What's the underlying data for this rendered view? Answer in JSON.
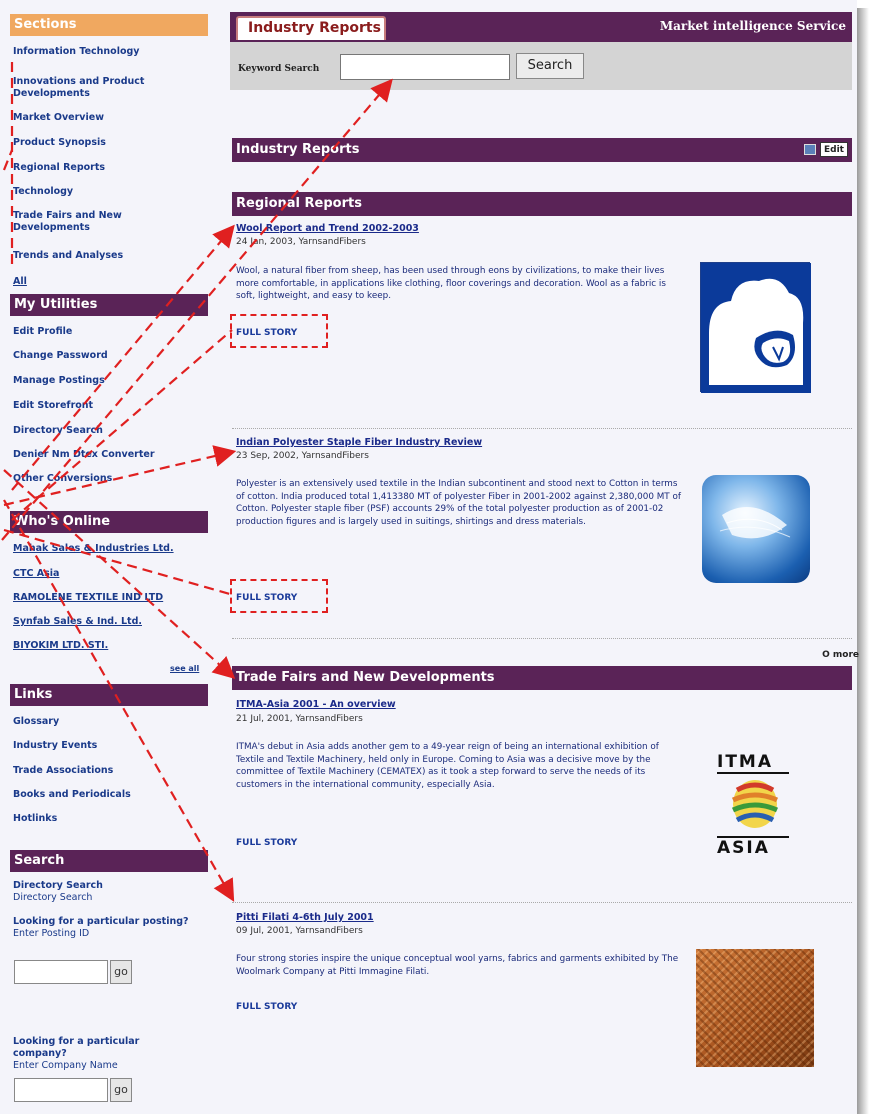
{
  "sidebar": {
    "sections_heading": "Sections",
    "sections": [
      "Information Technology",
      "Innovations and Product Developments",
      "Market Overview",
      "Product Synopsis",
      "Regional Reports",
      "Technology",
      "Trade Fairs and New Developments",
      "Trends and Analyses",
      "All"
    ],
    "utilities_heading": "My Utilities",
    "utilities": [
      "Edit Profile",
      "Change Password",
      "Manage Postings",
      "Edit Storefront",
      "Directory Search",
      "Denier Nm Dtex Converter",
      "Other Conversions"
    ],
    "whos_online_heading": "Who's Online",
    "online": [
      "Mahak Sales & Industries Ltd.",
      "CTC Asia",
      "RAMOLENE TEXTILE IND LTD",
      "Synfab Sales & Ind. Ltd.",
      "BIYOKIM LTD. STI."
    ],
    "online_more": "see all",
    "links_heading": "Links",
    "links": [
      "Glossary",
      "Industry Events",
      "Trade Associations",
      "Books and Periodicals",
      "Hotlinks"
    ],
    "search_heading": "Search",
    "dir_search_title": "Directory Search",
    "dir_search_sub": "Directory Search",
    "posting_q": "Looking for a particular posting?",
    "posting_label": "Enter Posting ID",
    "company_q": "Looking for a particular company?",
    "company_label": "Enter Company Name",
    "go_label": "go"
  },
  "header": {
    "tab_title": "Industry Reports",
    "service": "Market intelligence Service",
    "keyword_label": "Keyword Search",
    "search_button": "Search"
  },
  "main": {
    "industry_reports_bar": "Industry Reports",
    "edit_label": "Edit",
    "regional_bar": "Regional Reports",
    "trade_bar": "Trade Fairs and New Developments",
    "more_label": "O more",
    "full_story": "FULL STORY",
    "articles": [
      {
        "title": "Wool Report and Trend 2002-2003",
        "date": "24 Jan, 2003, YarnsandFibers",
        "body": "Wool, a natural fiber from sheep, has been used through eons by civilizations, to make their lives more comfortable, in applications like clothing, floor coverings and decoration. Wool as a fabric is soft, lightweight, and easy to keep."
      },
      {
        "title": "Indian Polyester Staple Fiber Industry Review",
        "date": "23 Sep, 2002, YarnsandFibers",
        "body": "Polyester is an extensively used textile in the Indian subcontinent and stood next to Cotton in terms of cotton. India produced total 1,413380 MT of polyester Fiber in 2001-2002 against 2,380,000 MT of Cotton. Polyester staple fiber (PSF) accounts 29% of the total polyester production as of 2001-02 production figures and is largely used in suitings, shirtings and dress materials."
      },
      {
        "title": "ITMA-Asia 2001 - An overview",
        "date": "21 Jul, 2001, YarnsandFibers",
        "body": "ITMA's debut in Asia adds another gem to a 49-year reign of being an international exhibition of Textile and Textile Machinery, held only in Europe. Coming to Asia was a decisive move by the committee of Textile Machinery (CEMATEX) as it took a step forward to serve the needs of its customers in the international community, especially Asia."
      },
      {
        "title": "Pitti Filati 4-6th July 2001",
        "date": "09 Jul, 2001, YarnsandFibers",
        "body": "Four strong stories inspire the unique conceptual wool yarns, fabrics and garments exhibited by The Woolmark Company at Pitti Immagine Filati."
      }
    ],
    "itma_logo_top": "ITMA",
    "itma_logo_bottom": "ASIA"
  },
  "colors": {
    "section_bar": "#5a2357",
    "sections_heading": "#f0a860",
    "link": "#1a3a8a",
    "annotation": "#e02020"
  }
}
